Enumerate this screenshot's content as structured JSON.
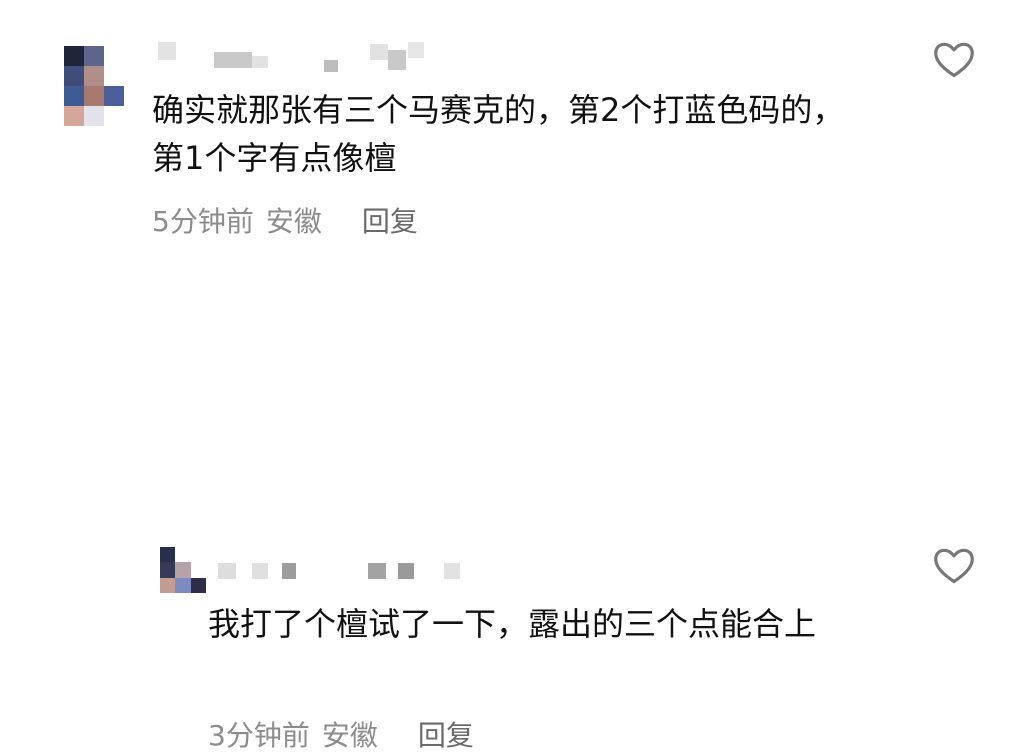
{
  "main_comment": {
    "text": "确实就那张有三个马赛克的，第2个打蓝色码的，第1个字有点像檀",
    "timestamp": "5分钟前",
    "location": "安徽",
    "reply_label": "回复",
    "like_icon": "heart-outline-icon"
  },
  "reply_comment": {
    "text": "我打了个檀试了一下，露出的三个点能合上",
    "timestamp": "3分钟前",
    "location": "安徽",
    "reply_label": "回复",
    "like_icon": "heart-outline-icon"
  },
  "colors": {
    "text_primary": "#111111",
    "text_secondary": "#8c8c8c",
    "icon_outline": "#777777",
    "reply_action": "#6a6a6a",
    "avatar_tones": [
      "#2a3552",
      "#3d4a71",
      "#8b8fa8",
      "#3f5a8d",
      "#b89792",
      "#d3c1c4",
      "#2f3046",
      "#7e8fc2",
      "#c9a39b"
    ],
    "blur_tones": [
      "#d8d8d8",
      "#9c9c9c",
      "#c9c9c9",
      "#bdbdbd"
    ]
  }
}
